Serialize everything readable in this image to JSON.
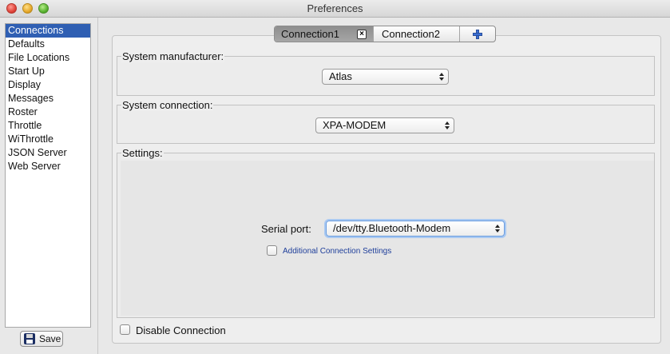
{
  "window": {
    "title": "Preferences"
  },
  "sidebar": {
    "items": [
      {
        "label": "Connections",
        "selected": true
      },
      {
        "label": "Defaults"
      },
      {
        "label": "File Locations"
      },
      {
        "label": "Start Up"
      },
      {
        "label": "Display"
      },
      {
        "label": "Messages"
      },
      {
        "label": "Roster"
      },
      {
        "label": "Throttle"
      },
      {
        "label": "WiThrottle"
      },
      {
        "label": "JSON Server"
      },
      {
        "label": "Web Server"
      }
    ],
    "save_label": "Save"
  },
  "tabs": [
    {
      "label": "Connection1",
      "active": true
    },
    {
      "label": "Connection2"
    }
  ],
  "system_manufacturer": {
    "label": "System manufacturer:",
    "value": "Atlas"
  },
  "system_connection": {
    "label": "System connection:",
    "value": "XPA-MODEM"
  },
  "settings": {
    "label": "Settings:",
    "serial_port_label": "Serial port:",
    "serial_port_value": "/dev/tty.Bluetooth-Modem",
    "additional_label": "Additional Connection Settings"
  },
  "disable_connection_label": "Disable Connection",
  "icons": {
    "close_tab": "close-icon",
    "add_tab": "plus-icon",
    "save": "disk-icon",
    "popup": "updown-icon"
  }
}
